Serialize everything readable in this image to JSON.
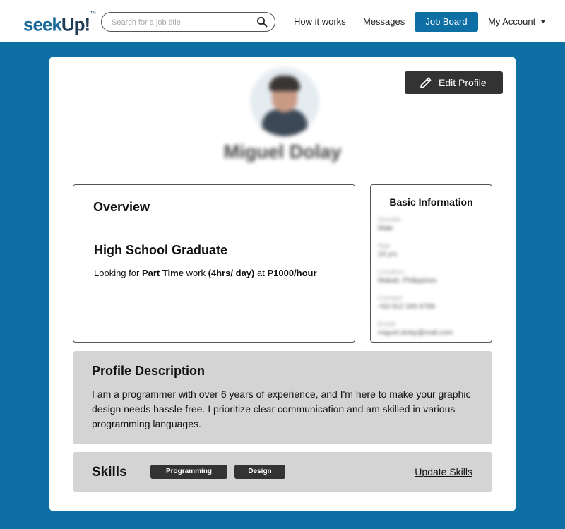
{
  "brand": {
    "logo_part1": "seek",
    "logo_part2": "Up!",
    "logo_mark": "™"
  },
  "search": {
    "placeholder": "Search for a job title",
    "value": "",
    "icon": "search-icon"
  },
  "nav": {
    "how_it_works": "How it works",
    "messages": "Messages",
    "job_board": "Job Board",
    "my_account": "My Account"
  },
  "profile": {
    "name": "Miguel Dolay",
    "edit_button": "Edit Profile"
  },
  "overview": {
    "title": "Overview",
    "headline": "High School Graduate",
    "availability": {
      "prefix": "Looking for ",
      "job_type": "Part Time",
      "mid1": " work ",
      "hours": "(4hrs/ day)",
      "mid2": " at ",
      "rate": "P1000/hour"
    }
  },
  "basic_info": {
    "title": "Basic Information",
    "rows": [
      {
        "label": "Gender",
        "value": "Male"
      },
      {
        "label": "Age",
        "value": "24 yrs"
      },
      {
        "label": "Location",
        "value": "Makati, Philippines"
      },
      {
        "label": "Contact",
        "value": "+63 912 345 6789"
      },
      {
        "label": "Email",
        "value": "miguel.dolay@mail.com"
      }
    ]
  },
  "description": {
    "title": "Profile Description",
    "text": "I am a programmer with over 6 years of experience, and I'm here to make your graphic design needs hassle-free. I prioritize clear communication and am skilled in various programming languages."
  },
  "skills": {
    "title": "Skills",
    "items": [
      "Programming",
      "Design"
    ],
    "update_link": "Update Skills"
  },
  "colors": {
    "primary": "#0e6fa4",
    "dark_button": "#333333",
    "panel_gray": "#d4d4d4"
  }
}
